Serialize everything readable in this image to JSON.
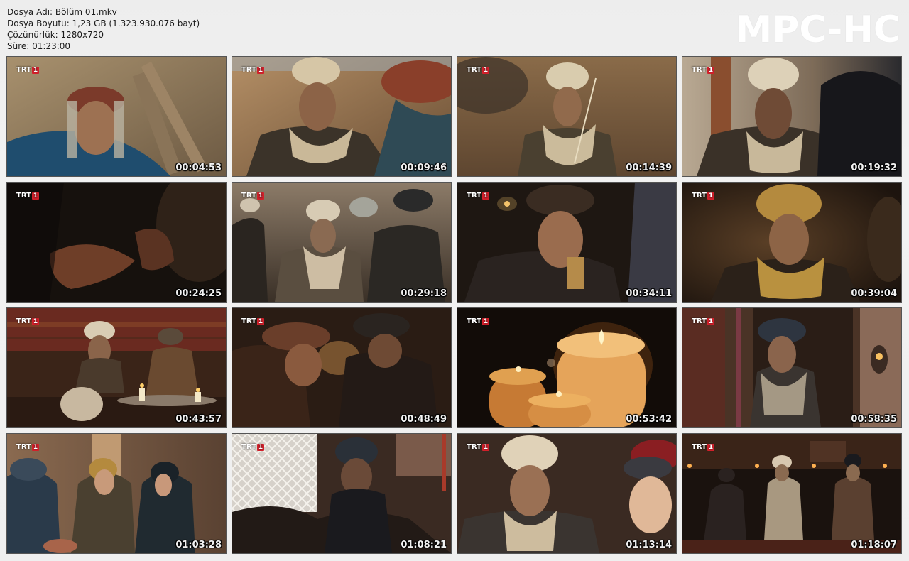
{
  "file_info": {
    "name": "Dosya Adı: Bölüm 01.mkv",
    "size": "Dosya Boyutu: 1,23 GB (1.323.930.076 bayt)",
    "resolution": "Çözünürlük: 1280x720",
    "duration": "Süre: 01:23:00"
  },
  "logo": "MPC-HC",
  "channel": {
    "text": "TRT",
    "number": "1",
    "color": "#d3202b"
  },
  "thumbnails": [
    {
      "time": "00:04:53",
      "scene": "turbaned-man-red-turban-outdoors"
    },
    {
      "time": "00:09:46",
      "scene": "two-men-outdoors-desert"
    },
    {
      "time": "00:14:39",
      "scene": "man-white-turban-field"
    },
    {
      "time": "00:19:32",
      "scene": "man-turban-dark-interior"
    },
    {
      "time": "00:24:25",
      "scene": "hand-closeup-dark"
    },
    {
      "time": "00:29:18",
      "scene": "group-of-men-courtyard"
    },
    {
      "time": "00:34:11",
      "scene": "man-holding-cup-candlelight"
    },
    {
      "time": "00:39:04",
      "scene": "man-yellow-turban-interior"
    },
    {
      "time": "00:43:57",
      "scene": "gathering-at-table-candles"
    },
    {
      "time": "00:48:49",
      "scene": "two-men-whispering"
    },
    {
      "time": "00:53:42",
      "scene": "candles-closeup"
    },
    {
      "time": "00:58:35",
      "scene": "man-in-doorway-lamp"
    },
    {
      "time": "01:03:28",
      "scene": "women-in-street"
    },
    {
      "time": "01:08:21",
      "scene": "man-dark-turban-window"
    },
    {
      "time": "01:13:14",
      "scene": "man-white-turban-and-child"
    },
    {
      "time": "01:18:07",
      "scene": "men-sitting-dark-room"
    }
  ],
  "colors": {
    "background": "#efefef",
    "text": "#1b1b1b",
    "logo": "#ffffff",
    "timestamp": "#f2f2f2"
  }
}
